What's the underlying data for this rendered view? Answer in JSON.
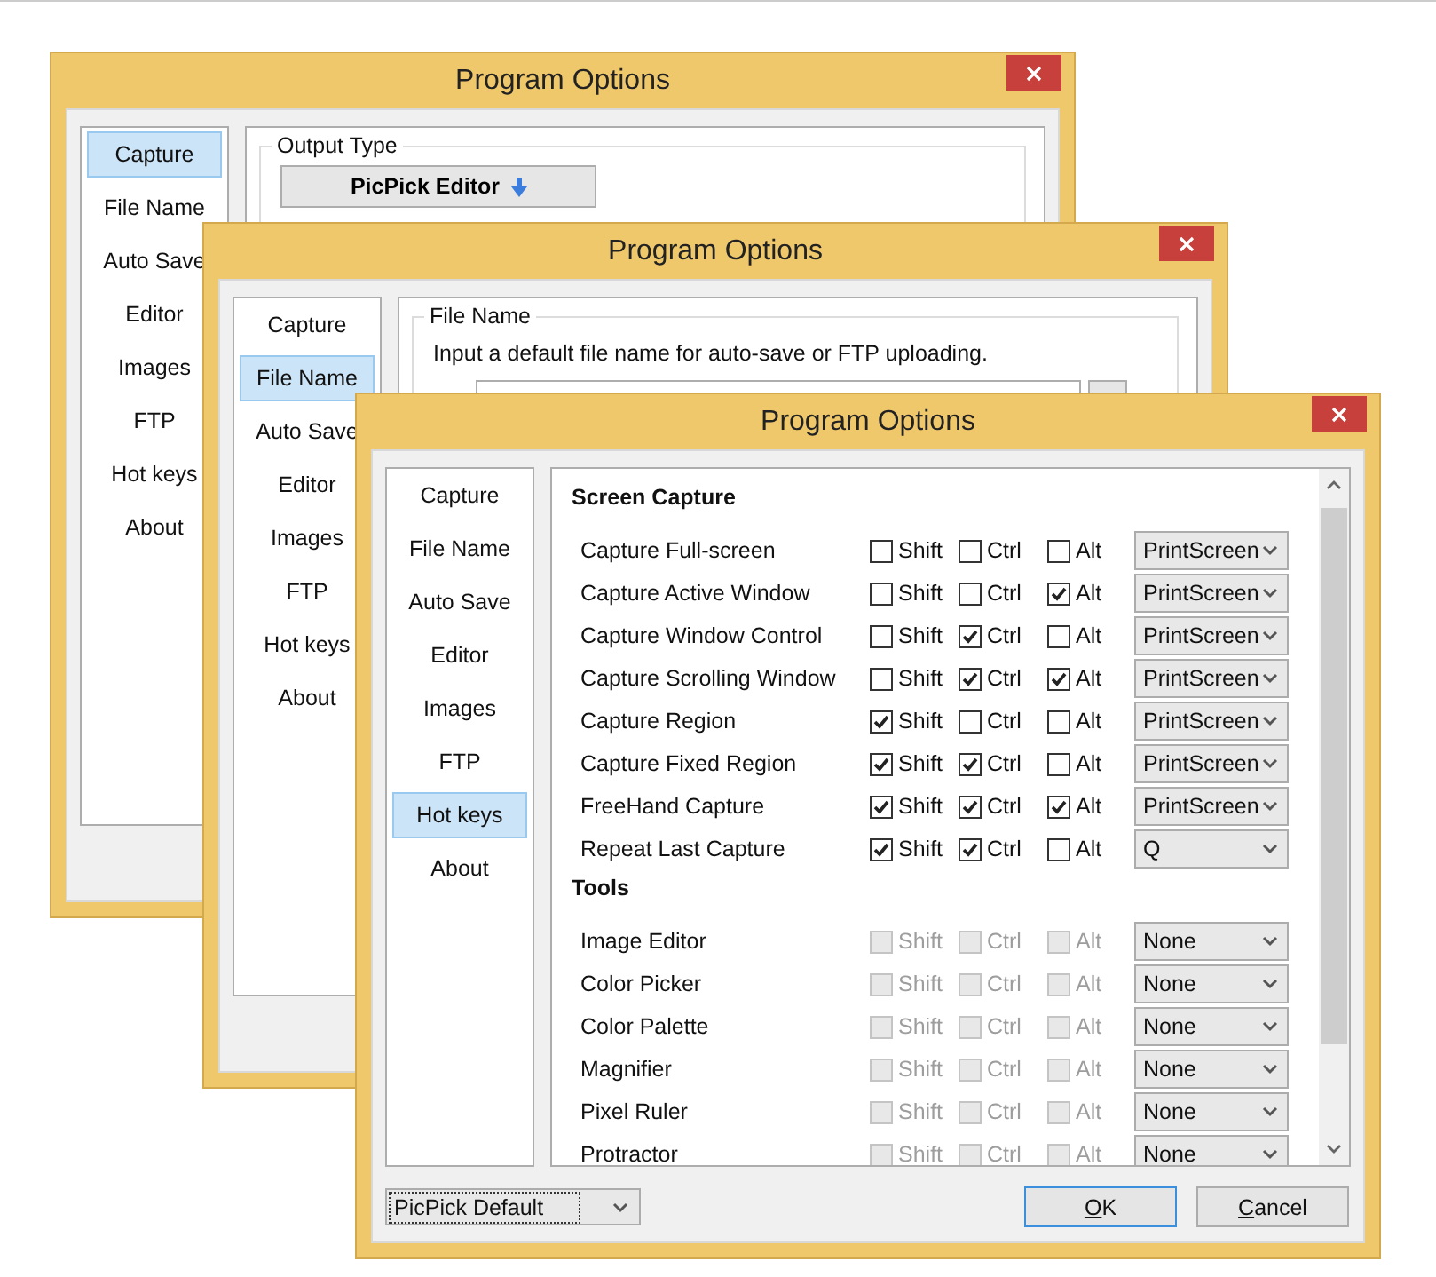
{
  "windows": [
    {
      "title": "Program Options",
      "kind": "output_type",
      "sidebar": [
        {
          "label": "Capture",
          "selected": true
        },
        {
          "label": "File Name",
          "selected": false
        },
        {
          "label": "Auto Save",
          "selected": false
        },
        {
          "label": "Editor",
          "selected": false
        },
        {
          "label": "Images",
          "selected": false
        },
        {
          "label": "FTP",
          "selected": false
        },
        {
          "label": "Hot keys",
          "selected": false
        },
        {
          "label": "About",
          "selected": false
        }
      ],
      "group": {
        "legend": "Output Type",
        "button": "PicPick Editor"
      }
    },
    {
      "title": "Program Options",
      "kind": "file_name",
      "sidebar": [
        {
          "label": "Capture",
          "selected": false
        },
        {
          "label": "File Name",
          "selected": true
        },
        {
          "label": "Auto Save",
          "selected": false
        },
        {
          "label": "Editor",
          "selected": false
        },
        {
          "label": "Images",
          "selected": false
        },
        {
          "label": "FTP",
          "selected": false
        },
        {
          "label": "Hot keys",
          "selected": false
        },
        {
          "label": "About",
          "selected": false
        }
      ],
      "group": {
        "legend": "File Name",
        "hint": "Input a default file name for auto-save or FTP uploading."
      }
    },
    {
      "title": "Program Options",
      "kind": "hot_keys",
      "sidebar": [
        {
          "label": "Capture",
          "selected": false
        },
        {
          "label": "File Name",
          "selected": false
        },
        {
          "label": "Auto Save",
          "selected": false
        },
        {
          "label": "Editor",
          "selected": false
        },
        {
          "label": "Images",
          "selected": false
        },
        {
          "label": "FTP",
          "selected": false
        },
        {
          "label": "Hot keys",
          "selected": true
        },
        {
          "label": "About",
          "selected": false
        }
      ],
      "sections": [
        {
          "heading": "Screen Capture",
          "rows": [
            {
              "label": "Capture Full-screen",
              "disabled": false,
              "modifiers": [
                {
                  "label": "Shift",
                  "checked": false
                },
                {
                  "label": "Ctrl",
                  "checked": false
                },
                {
                  "label": "Alt",
                  "checked": false
                }
              ],
              "key": "PrintScreen"
            },
            {
              "label": "Capture Active Window",
              "disabled": false,
              "modifiers": [
                {
                  "label": "Shift",
                  "checked": false
                },
                {
                  "label": "Ctrl",
                  "checked": false
                },
                {
                  "label": "Alt",
                  "checked": true
                }
              ],
              "key": "PrintScreen"
            },
            {
              "label": "Capture Window Control",
              "disabled": false,
              "modifiers": [
                {
                  "label": "Shift",
                  "checked": false
                },
                {
                  "label": "Ctrl",
                  "checked": true
                },
                {
                  "label": "Alt",
                  "checked": false
                }
              ],
              "key": "PrintScreen"
            },
            {
              "label": "Capture Scrolling Window",
              "disabled": false,
              "modifiers": [
                {
                  "label": "Shift",
                  "checked": false
                },
                {
                  "label": "Ctrl",
                  "checked": true
                },
                {
                  "label": "Alt",
                  "checked": true
                }
              ],
              "key": "PrintScreen"
            },
            {
              "label": "Capture Region",
              "disabled": false,
              "modifiers": [
                {
                  "label": "Shift",
                  "checked": true
                },
                {
                  "label": "Ctrl",
                  "checked": false
                },
                {
                  "label": "Alt",
                  "checked": false
                }
              ],
              "key": "PrintScreen"
            },
            {
              "label": "Capture Fixed Region",
              "disabled": false,
              "modifiers": [
                {
                  "label": "Shift",
                  "checked": true
                },
                {
                  "label": "Ctrl",
                  "checked": true
                },
                {
                  "label": "Alt",
                  "checked": false
                }
              ],
              "key": "PrintScreen"
            },
            {
              "label": "FreeHand Capture",
              "disabled": false,
              "modifiers": [
                {
                  "label": "Shift",
                  "checked": true
                },
                {
                  "label": "Ctrl",
                  "checked": true
                },
                {
                  "label": "Alt",
                  "checked": true
                }
              ],
              "key": "PrintScreen"
            },
            {
              "label": "Repeat Last Capture",
              "disabled": false,
              "modifiers": [
                {
                  "label": "Shift",
                  "checked": true
                },
                {
                  "label": "Ctrl",
                  "checked": true
                },
                {
                  "label": "Alt",
                  "checked": false
                }
              ],
              "key": "Q"
            }
          ]
        },
        {
          "heading": "Tools",
          "rows": [
            {
              "label": "Image Editor",
              "disabled": true,
              "modifiers": [
                {
                  "label": "Shift",
                  "checked": false
                },
                {
                  "label": "Ctrl",
                  "checked": false
                },
                {
                  "label": "Alt",
                  "checked": false
                }
              ],
              "key": "None"
            },
            {
              "label": "Color Picker",
              "disabled": true,
              "modifiers": [
                {
                  "label": "Shift",
                  "checked": false
                },
                {
                  "label": "Ctrl",
                  "checked": false
                },
                {
                  "label": "Alt",
                  "checked": false
                }
              ],
              "key": "None"
            },
            {
              "label": "Color Palette",
              "disabled": true,
              "modifiers": [
                {
                  "label": "Shift",
                  "checked": false
                },
                {
                  "label": "Ctrl",
                  "checked": false
                },
                {
                  "label": "Alt",
                  "checked": false
                }
              ],
              "key": "None"
            },
            {
              "label": "Magnifier",
              "disabled": true,
              "modifiers": [
                {
                  "label": "Shift",
                  "checked": false
                },
                {
                  "label": "Ctrl",
                  "checked": false
                },
                {
                  "label": "Alt",
                  "checked": false
                }
              ],
              "key": "None"
            },
            {
              "label": "Pixel Ruler",
              "disabled": true,
              "modifiers": [
                {
                  "label": "Shift",
                  "checked": false
                },
                {
                  "label": "Ctrl",
                  "checked": false
                },
                {
                  "label": "Alt",
                  "checked": false
                }
              ],
              "key": "None"
            },
            {
              "label": "Protractor",
              "disabled": true,
              "modifiers": [
                {
                  "label": "Shift",
                  "checked": false
                },
                {
                  "label": "Ctrl",
                  "checked": false
                },
                {
                  "label": "Alt",
                  "checked": false
                }
              ],
              "key": "None"
            }
          ]
        }
      ],
      "footer": {
        "preset": "PicPick Default",
        "buttons": [
          {
            "accel": "O",
            "rest": "K",
            "default": true
          },
          {
            "accel": "C",
            "rest": "ancel",
            "default": false
          }
        ]
      }
    }
  ]
}
